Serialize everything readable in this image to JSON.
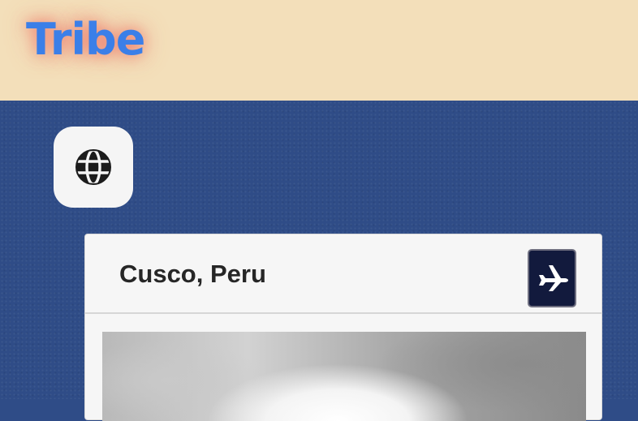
{
  "app": {
    "logo_text": "Tribe"
  },
  "nav": {
    "globe_button_icon": "globe-icon"
  },
  "card": {
    "title": "Cusco, Peru",
    "action_icon": "airplane-icon",
    "image_description": "cloudy-sky-photo"
  },
  "colors": {
    "header_bg": "#f3dfba",
    "logo": "#3b7fe8",
    "logo_glow": "#ee5f55",
    "page_bg": "#2f4c87",
    "plane_button_bg": "#121a3d",
    "card_bg": "#f6f6f6"
  }
}
